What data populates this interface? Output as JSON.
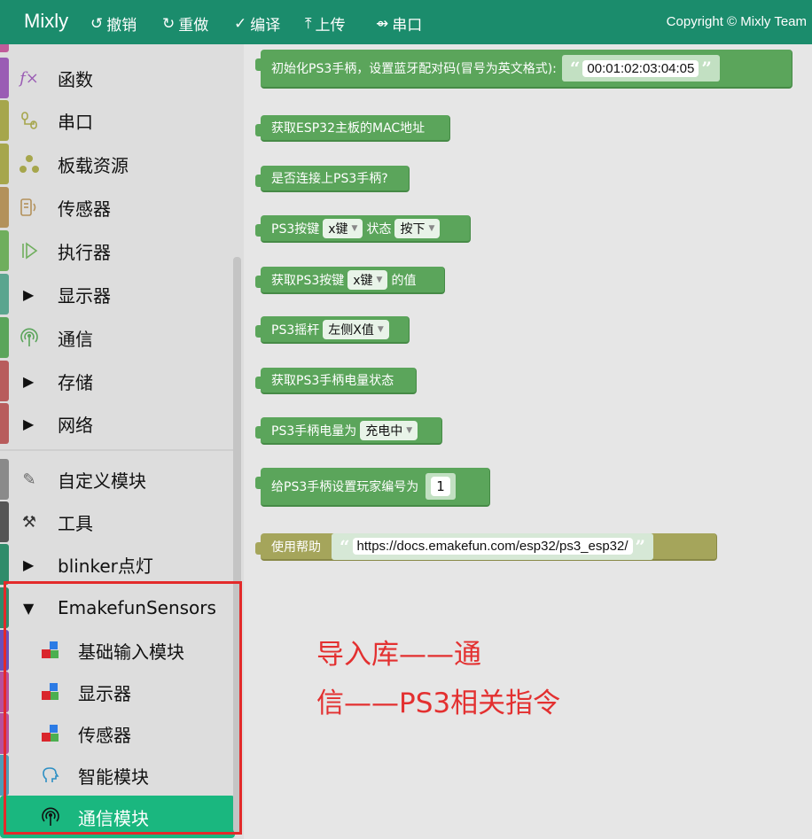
{
  "app": {
    "logo": "Mixly",
    "copyright": "Copyright © Mixly Team",
    "toolbar": [
      {
        "icon": "undo-icon",
        "glyph": "↺",
        "label": "撤销"
      },
      {
        "icon": "redo-icon",
        "glyph": "↻",
        "label": "重做"
      },
      {
        "icon": "check-icon",
        "glyph": "✓",
        "label": "编译"
      },
      {
        "icon": "upload-icon",
        "glyph": "⤒",
        "label": "上传"
      },
      {
        "icon": "usb-icon",
        "glyph": "⇴",
        "label": "串口"
      }
    ]
  },
  "sidebar": {
    "items": [
      {
        "label": "函数",
        "icon": "function-icon",
        "color": "#9a5cb4"
      },
      {
        "label": "串口",
        "icon": "serial-icon",
        "color": "#a6a64c"
      },
      {
        "label": "板载资源",
        "icon": "board-icon",
        "color": "#a6a64c"
      },
      {
        "label": "传感器",
        "icon": "sensor-icon",
        "color": "#b3915b"
      },
      {
        "label": "执行器",
        "icon": "actuator-icon",
        "color": "#6fae5d"
      },
      {
        "label": "显示器",
        "icon": "triangle-right-icon",
        "color": "#5ba58f"
      },
      {
        "label": "通信",
        "icon": "antenna-icon",
        "color": "#5ba55b"
      },
      {
        "label": "存储",
        "icon": "triangle-right-icon",
        "color": "#b85c5c"
      },
      {
        "label": "网络",
        "icon": "triangle-right-icon",
        "color": "#b85c5c"
      },
      {
        "label": "自定义模块",
        "icon": "pencil-icon",
        "color": "#8a8a8a"
      },
      {
        "label": "工具",
        "icon": "tools-icon",
        "color": "#555555"
      },
      {
        "label": "blinker点灯",
        "icon": "triangle-right-icon",
        "color": "#2f8c6a"
      },
      {
        "label": "EmakefunSensors",
        "icon": "triangle-down-icon",
        "color": "#2f8c6a"
      },
      {
        "label": "基础输入模块",
        "icon": "blocks-icon",
        "color": "#6b4fbb"
      },
      {
        "label": "显示器",
        "icon": "blocks-icon",
        "color": "#b84f9c"
      },
      {
        "label": "传感器",
        "icon": "blocks-icon",
        "color": "#b84f9c"
      },
      {
        "label": "智能模块",
        "icon": "brain-icon",
        "color": "#4f9cb8"
      },
      {
        "label": "通信模块",
        "icon": "antenna-icon",
        "color": "#2f8c6a"
      }
    ]
  },
  "blocks": {
    "init": {
      "label": "初始化PS3手柄，设置蓝牙配对码(冒号为英文格式):",
      "value": "00:01:02:03:04:05"
    },
    "mac": {
      "label": "获取ESP32主板的MAC地址"
    },
    "connected": {
      "label": "是否连接上PS3手柄?"
    },
    "button_state": {
      "label_a": "PS3按键",
      "dropdown1": "x键",
      "label_b": "状态",
      "dropdown2": "按下"
    },
    "button_value": {
      "label_a": "获取PS3按键",
      "dropdown": "x键",
      "label_b": "的值"
    },
    "stick": {
      "label": "PS3摇杆",
      "dropdown": "左侧X值"
    },
    "battery_status": {
      "label": "获取PS3手柄电量状态"
    },
    "battery_is": {
      "label": "PS3手柄电量为",
      "dropdown": "充电中"
    },
    "player": {
      "label": "给PS3手柄设置玩家编号为",
      "value": "1"
    },
    "help": {
      "label": "使用帮助",
      "url": "https://docs.emakefun.com/esp32/ps3_esp32/"
    }
  },
  "annotation": {
    "line1": "导入库——通",
    "line2": "信——PS3相关指令",
    "color": "#e33030"
  }
}
